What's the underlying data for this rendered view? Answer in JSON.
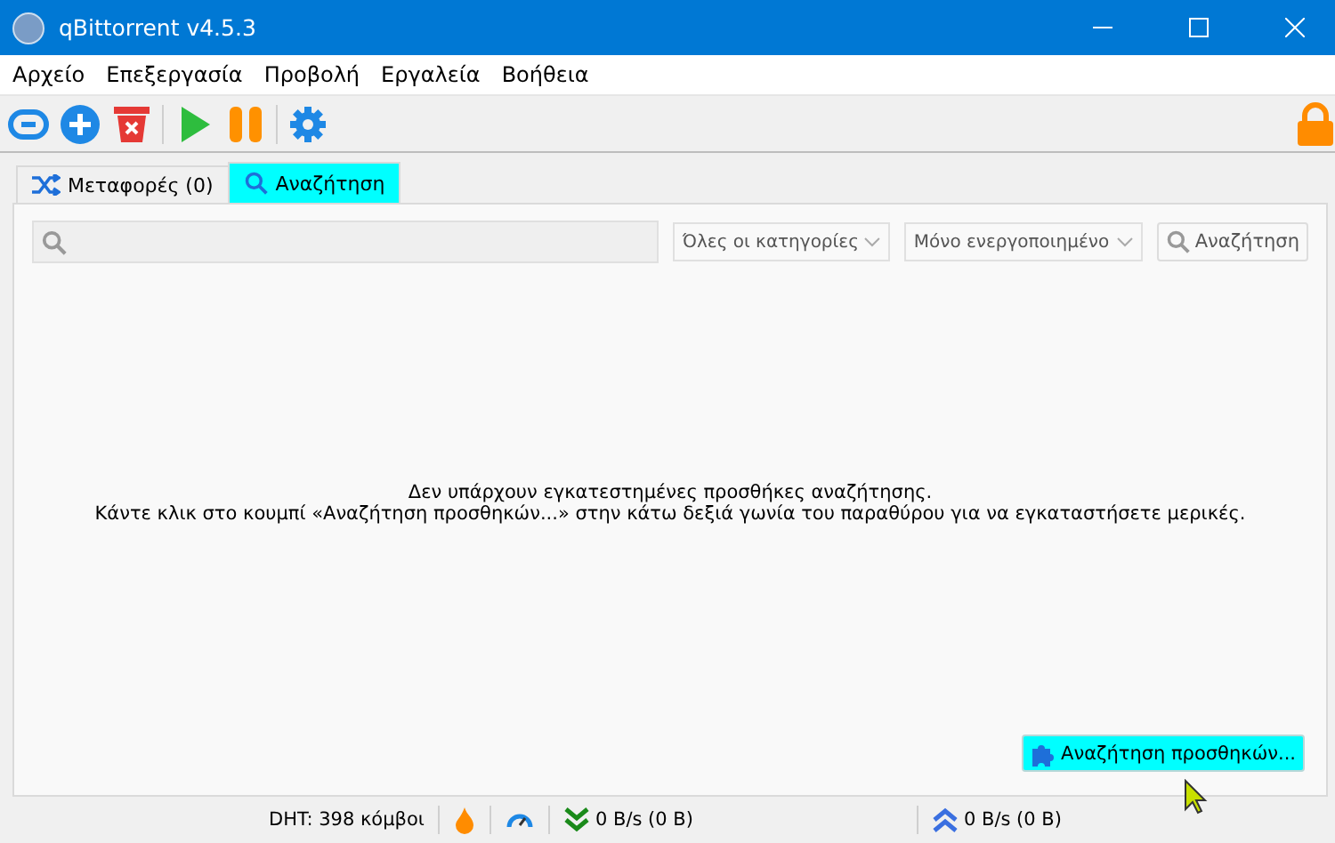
{
  "window": {
    "title": "qBittorrent v4.5.3"
  },
  "menu": [
    "Αρχείο",
    "Επεξεργασία",
    "Προβολή",
    "Εργαλεία",
    "Βοήθεια"
  ],
  "toolbar": [
    {
      "kind": "link"
    },
    {
      "kind": "add"
    },
    {
      "kind": "delete"
    },
    {
      "kind": "separator"
    },
    {
      "kind": "resume"
    },
    {
      "kind": "pause"
    },
    {
      "kind": "separator"
    },
    {
      "kind": "options"
    }
  ],
  "tabs": [
    {
      "label": "Μεταφορές (0)",
      "kind": "transfers",
      "selected": false
    },
    {
      "label": "Αναζήτηση",
      "kind": "search",
      "selected": true
    }
  ],
  "search": {
    "category": "Όλες οι κατηγορίες",
    "plugins": "Μόνο ενεργοποιημένο",
    "button": "Αναζήτηση"
  },
  "message": [
    "Δεν υπάρχουν εγκατεστημένες προσθήκες αναζήτησης.",
    "Κάντε κλικ στο κουμπί «Αναζήτηση προσθηκών...» στην κάτω δεξιά γωνία του παραθύρου για να εγκαταστήσετε μερικές."
  ],
  "plugins_button": "Αναζήτηση προσθηκών...",
  "status_bar": {
    "dht": "DHT: 398 κόμβοι",
    "download": "0 B/s (0 B)",
    "upload": "0 B/s (0 B)"
  }
}
